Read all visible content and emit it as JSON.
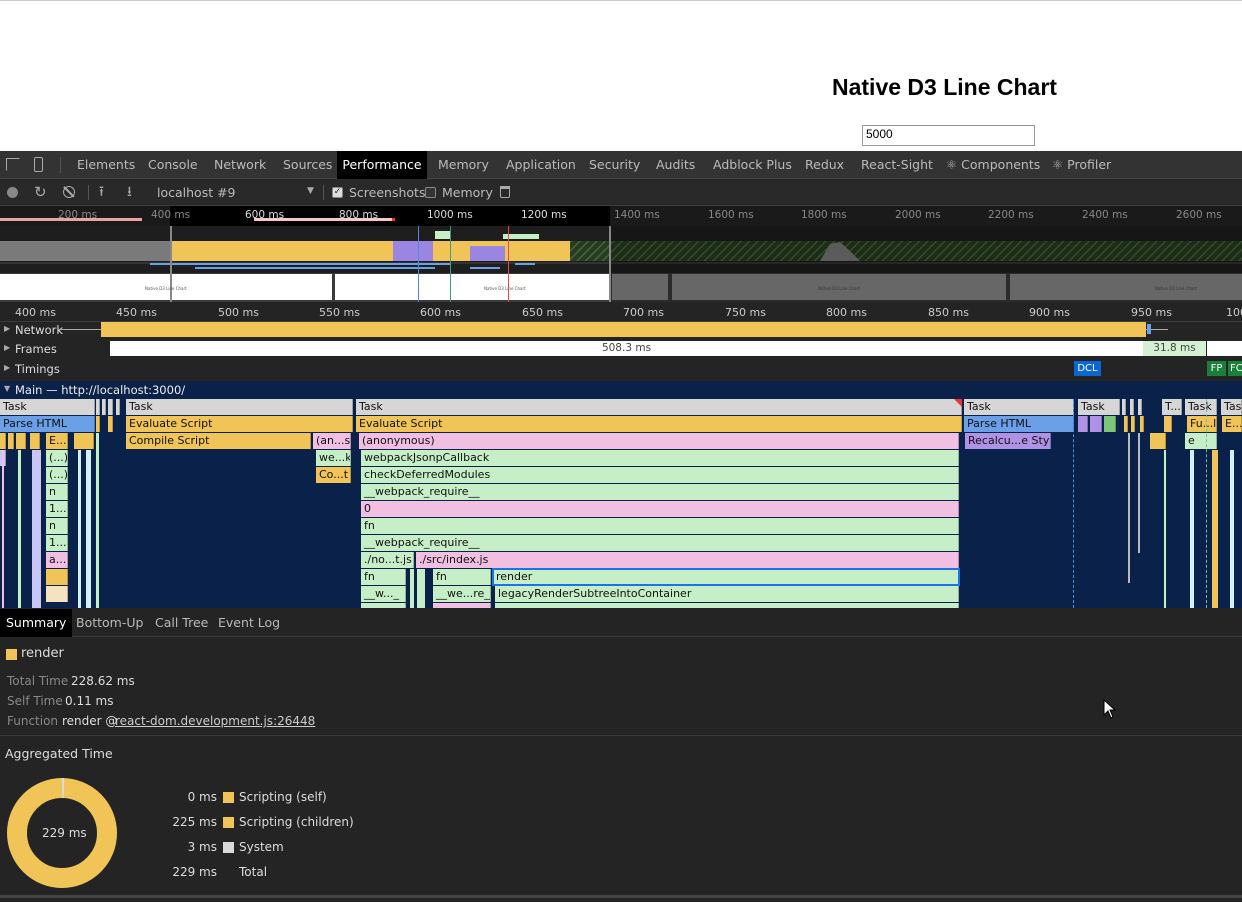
{
  "page": {
    "title": "Native D3 Line Chart",
    "input_value": "5000"
  },
  "devtools": {
    "tabs": [
      {
        "label": "Elements"
      },
      {
        "label": "Console"
      },
      {
        "label": "Network"
      },
      {
        "label": "Sources"
      },
      {
        "label": "Performance",
        "active": true
      },
      {
        "label": "Memory"
      },
      {
        "label": "Application"
      },
      {
        "label": "Security"
      },
      {
        "label": "Audits"
      },
      {
        "label": "Adblock Plus"
      },
      {
        "label": "Redux"
      },
      {
        "label": "React-Sight"
      },
      {
        "label": "⚛ Components"
      },
      {
        "label": "⚛ Profiler"
      }
    ],
    "toolbar": {
      "profile_select": "localhost #9",
      "screenshots_label": "Screenshots",
      "screenshots_checked": true,
      "memory_label": "Memory",
      "memory_checked": false
    },
    "overview_ticks": [
      "200 ms",
      "400 ms",
      "600 ms",
      "800 ms",
      "1000 ms",
      "1200 ms",
      "1400 ms",
      "1600 ms",
      "1800 ms",
      "2000 ms",
      "2200 ms",
      "2400 ms",
      "2600 ms"
    ],
    "ruler_ticks": [
      "400 ms",
      "450 ms",
      "500 ms",
      "550 ms",
      "600 ms",
      "650 ms",
      "700 ms",
      "750 ms",
      "800 ms",
      "850 ms",
      "900 ms",
      "950 ms",
      "100"
    ],
    "screenshot_thumb_label": "Native D3 Line Chart",
    "tracks": {
      "network": "Network",
      "frames": "Frames",
      "frame_long": "508.3 ms",
      "frame_short": "31.8 ms",
      "timings": "Timings",
      "dcl": "DCL",
      "fp": "FP",
      "fcp": "FC",
      "main": "Main — http://localhost:3000/"
    },
    "flame": {
      "tasks": [
        "Task",
        "Task",
        "Task",
        "Task",
        "Task",
        "T...",
        "Task",
        "Task"
      ],
      "entries": [
        "Parse HTML",
        "Evaluate Script",
        "Evaluate Script",
        "Parse HTML",
        "E...",
        "Compile Script",
        "(an...s)",
        "(anonymous)",
        "Recalcu...e Style",
        "(...)",
        "we...k",
        "webpackJsonpCallback",
        "(...)",
        "Co...t",
        "checkDeferredModules",
        "n",
        "__webpack_require__",
        "1...",
        "0",
        "n",
        "fn",
        "1...",
        "__webpack_require__",
        "a...",
        "./no...t.js",
        "./src/index.js",
        "fn",
        "fn",
        "render",
        "__w..._",
        "__we...re__",
        "legacyRenderSubtreeIntoContainer",
        "Fu...ll",
        "E...t",
        "e"
      ]
    },
    "bottom_tabs": [
      {
        "label": "Summary",
        "active": true
      },
      {
        "label": "Bottom-Up"
      },
      {
        "label": "Call Tree"
      },
      {
        "label": "Event Log"
      }
    ],
    "summary": {
      "name": "render",
      "total_time_label": "Total Time",
      "total_time": "228.62 ms",
      "self_time_label": "Self Time",
      "self_time": "0.11 ms",
      "function_label": "Function",
      "function_name": "render @ ",
      "function_link": "react-dom.development.js:26448",
      "aggregated_title": "Aggregated Time",
      "donut_center": "229 ms",
      "rows": [
        {
          "value": "0 ms",
          "label": "Scripting (self)",
          "color": "#f0c457"
        },
        {
          "value": "225 ms",
          "label": "Scripting (children)",
          "color": "#f0c457"
        },
        {
          "value": "3 ms",
          "label": "System",
          "color": "#dadada"
        },
        {
          "value": "229 ms",
          "label": "Total",
          "color": ""
        }
      ]
    }
  },
  "colors": {
    "scripting": "#f0c457",
    "rendering": "#af91e5",
    "painting": "#7cc67c",
    "loading": "#6b9fe8",
    "flame_bg": "#0a2149",
    "pink": "#f0bfe1",
    "green": "#c7efc7"
  }
}
